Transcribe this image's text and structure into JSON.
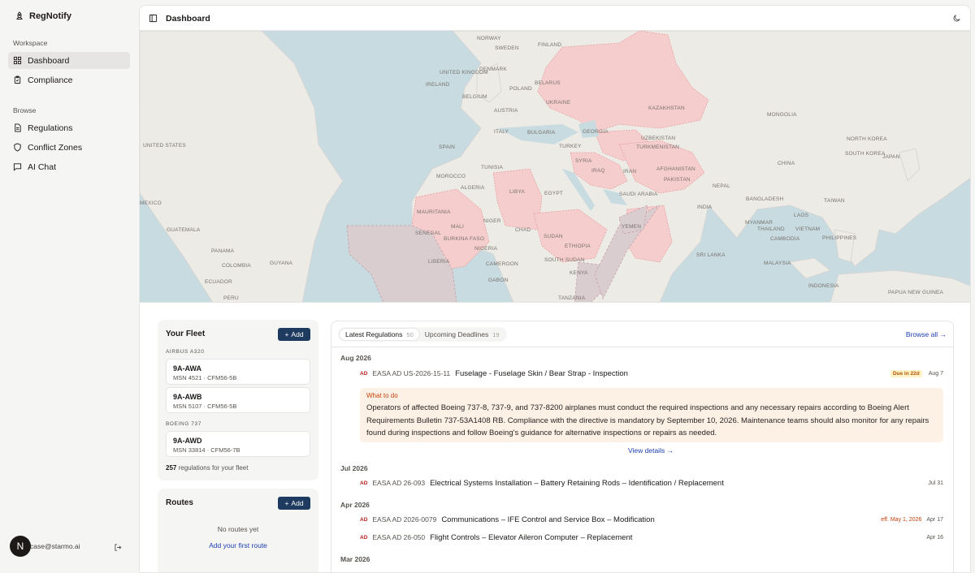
{
  "app": {
    "name": "RegNotify"
  },
  "sidebar": {
    "workspace_label": "Workspace",
    "browse_label": "Browse",
    "workspace_items": [
      {
        "label": "Dashboard",
        "icon": "grid-icon",
        "active": true
      },
      {
        "label": "Compliance",
        "icon": "clipboard-check-icon",
        "active": false
      }
    ],
    "browse_items": [
      {
        "label": "Regulations",
        "icon": "document-icon"
      },
      {
        "label": "Conflict Zones",
        "icon": "shield-icon"
      },
      {
        "label": "AI Chat",
        "icon": "chat-icon"
      }
    ],
    "user": {
      "initial": "N",
      "email": "case@starmo.ai"
    }
  },
  "header": {
    "title": "Dashboard"
  },
  "map": {
    "labels": [
      "NORWAY",
      "SWEDEN",
      "FINLAND",
      "UNITED KINGDOM",
      "IRELAND",
      "DENMARK",
      "POLAND",
      "BELARUS",
      "BELGIUM",
      "UKRAINE",
      "AUSTRIA",
      "KAZAKHSTAN",
      "MONGOLIA",
      "ITALY",
      "BULGARIA",
      "GEORGIA",
      "UZBEKISTAN",
      "NORTH KOREA",
      "UNITED STATES",
      "SPAIN",
      "TURKEY",
      "TURKMENISTAN",
      "SOUTH KOREA",
      "JAPAN",
      "SYRIA",
      "IRAQ",
      "IRAN",
      "AFGHANISTAN",
      "CHINA",
      "TUNISIA",
      "MOROCCO",
      "ALGERIA",
      "LIBYA",
      "EGYPT",
      "PAKISTAN",
      "NEPAL",
      "SAUDI ARABIA",
      "INDIA",
      "BANGLADESH",
      "TAIWAN",
      "MEXICO",
      "MAURITANIA",
      "MALI",
      "NIGER",
      "CHAD",
      "SUDAN",
      "YEMEN",
      "LAOS",
      "GUATEMALA",
      "SENEGAL",
      "BURKINA FASO",
      "NIGERIA",
      "ETHIOPIA",
      "MYANMAR",
      "VIETNAM",
      "PHILIPPINES",
      "THAILAND",
      "CAMBODIA",
      "PANAMA",
      "GUYANA",
      "COLOMBIA",
      "LIBERIA",
      "CAMEROON",
      "SOUTH SUDAN",
      "SRI LANKA",
      "ECUADOR",
      "GABON",
      "KENYA",
      "MALAYSIA",
      "INDONESIA",
      "PERU",
      "TANZANIA",
      "PAPUA NEW GUINEA"
    ]
  },
  "fleet": {
    "title": "Your Fleet",
    "add_label": "Add",
    "groups": [
      {
        "name": "AIRBUS A320",
        "aircraft": [
          {
            "reg": "9A-AWA",
            "msn": "MSN 4521 · CFM56-5B"
          },
          {
            "reg": "9A-AWB",
            "msn": "MSN 5107 · CFM56-5B"
          }
        ]
      },
      {
        "name": "BOEING 737",
        "aircraft": [
          {
            "reg": "9A-AWD",
            "msn": "MSN 33814 · CFM56-7B"
          }
        ]
      }
    ],
    "reg_count": "257",
    "reg_count_suffix": "regulations for your fleet"
  },
  "routes": {
    "title": "Routes",
    "add_label": "Add",
    "empty_text": "No routes yet",
    "add_first_label": "Add your first route"
  },
  "feed": {
    "tabs": [
      {
        "label": "Latest Regulations",
        "count": "50",
        "active": true
      },
      {
        "label": "Upcoming Deadlines",
        "count": "19",
        "active": false
      }
    ],
    "browse_all": "Browse all →",
    "months": [
      "Aug 2026",
      "Jul 2026",
      "Apr 2026",
      "Mar 2026"
    ],
    "items": [
      {
        "type": "AD",
        "number": "EASA AD US-2026-15-11",
        "title": "Fuselage - Fuselage Skin / Bear Strap - Inspection",
        "badge": "Due in 22d",
        "date": "Aug 7"
      },
      {
        "type": "AD",
        "number": "EASA AD 26-093",
        "title": "Electrical Systems Installation – Battery Retaining Rods – Identification / Replacement",
        "date": "Jul 31"
      },
      {
        "type": "AD",
        "number": "EASA AD 2026-0079",
        "title": "Communications – IFE Control and Service Box – Modification",
        "effective": "eff. May 1, 2026",
        "date": "Apr 17"
      },
      {
        "type": "AD",
        "number": "EASA AD 26-050",
        "title": "Flight Controls – Elevator Aileron Computer – Replacement",
        "date": "Apr 16"
      }
    ],
    "what_to_do": {
      "heading": "What to do",
      "body": "Operators of affected Boeing 737-8, 737-9, and 737-8200 airplanes must conduct the required inspections and any necessary repairs according to Boeing Alert Requirements Bulletin 737-53A1408 RB. Compliance with the directive is mandatory by September 10, 2026. Maintenance teams should also monitor for any repairs found during inspections and follow Boeing's guidance for alternative inspections or repairs as needed."
    },
    "view_details": "View details →"
  },
  "colors": {
    "accent": "#1e3a5f",
    "conflict": "#f5c6c6",
    "due": "#b45309",
    "link": "#1e40af"
  }
}
